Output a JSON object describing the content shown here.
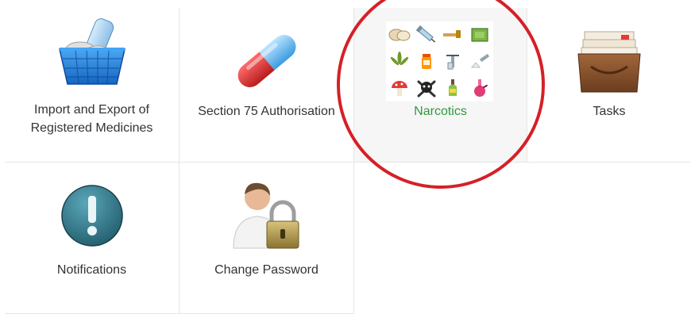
{
  "tiles": [
    {
      "id": "import-export",
      "label_line1": "Import and Export of",
      "label_line2": "Registered Medicines",
      "icon": "medicine-basket-icon"
    },
    {
      "id": "section75",
      "label": "Section 75 Authorisation",
      "icon": "capsule-icon"
    },
    {
      "id": "narcotics",
      "label": "Narcotics",
      "icon": "narcotics-collage-icon",
      "selected": true
    },
    {
      "id": "tasks",
      "label": "Tasks",
      "icon": "file-box-icon"
    },
    {
      "id": "notifications",
      "label": "Notifications",
      "icon": "info-alert-icon"
    },
    {
      "id": "change-password",
      "label": "Change Password",
      "icon": "user-lock-icon"
    }
  ],
  "colors": {
    "active_label": "#2e9a3a",
    "highlight_circle": "#d52027",
    "border": "#e6e6e6"
  }
}
